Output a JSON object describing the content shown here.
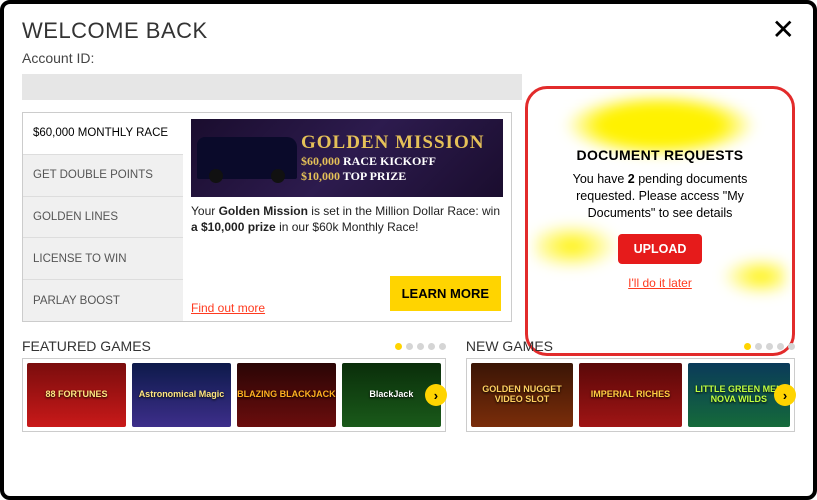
{
  "header": {
    "title": "WELCOME BACK",
    "account_label": "Account ID:",
    "account_value": ""
  },
  "promo": {
    "tabs": [
      "$60,000 MONTHLY RACE",
      "GET DOUBLE POINTS",
      "GOLDEN LINES",
      "LICENSE TO WIN",
      "PARLAY BOOST"
    ],
    "banner": {
      "line1": "GOLDEN MISSION",
      "line2_a": "$60,000",
      "line2_b": " RACE KICKOFF",
      "line3_a": "$10,000",
      "line3_b": " TOP PRIZE"
    },
    "desc_pre": "Your ",
    "desc_b1": "Golden Mission",
    "desc_mid": " is set in the Million Dollar Race: win ",
    "desc_b2": "a $10,000 prize",
    "desc_post": " in our $60k Monthly Race!",
    "find_out": "Find out more",
    "learn_more": "LEARN MORE"
  },
  "docs": {
    "title": "DOCUMENT REQUESTS",
    "msg_pre": "You have ",
    "msg_count": "2",
    "msg_post": " pending documents requested. Please access \"My Documents\" to see details",
    "upload": "UPLOAD",
    "later": "I'll do it later"
  },
  "featured": {
    "title": "FEATURED GAMES",
    "games": [
      "88 FORTUNES",
      "Astronomical Magic",
      "BLAZING BLACKJACK",
      "BlackJack"
    ]
  },
  "newgames": {
    "title": "NEW GAMES",
    "games": [
      "GOLDEN NUGGET VIDEO SLOT",
      "IMPERIAL RICHES",
      "LITTLE GREEN MEN NOVA WILDS"
    ]
  }
}
